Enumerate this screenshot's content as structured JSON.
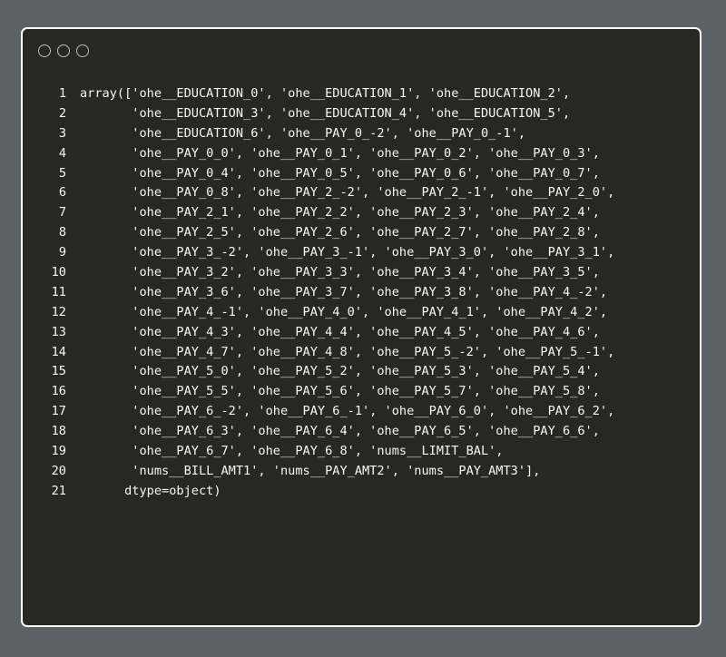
{
  "window": {
    "controls": [
      "close",
      "minimize",
      "maximize"
    ]
  },
  "code": {
    "lines": [
      "array(['ohe__EDUCATION_0', 'ohe__EDUCATION_1', 'ohe__EDUCATION_2',",
      "       'ohe__EDUCATION_3', 'ohe__EDUCATION_4', 'ohe__EDUCATION_5',",
      "       'ohe__EDUCATION_6', 'ohe__PAY_0_-2', 'ohe__PAY_0_-1',",
      "       'ohe__PAY_0_0', 'ohe__PAY_0_1', 'ohe__PAY_0_2', 'ohe__PAY_0_3',",
      "       'ohe__PAY_0_4', 'ohe__PAY_0_5', 'ohe__PAY_0_6', 'ohe__PAY_0_7',",
      "       'ohe__PAY_0_8', 'ohe__PAY_2_-2', 'ohe__PAY_2_-1', 'ohe__PAY_2_0',",
      "       'ohe__PAY_2_1', 'ohe__PAY_2_2', 'ohe__PAY_2_3', 'ohe__PAY_2_4',",
      "       'ohe__PAY_2_5', 'ohe__PAY_2_6', 'ohe__PAY_2_7', 'ohe__PAY_2_8',",
      "       'ohe__PAY_3_-2', 'ohe__PAY_3_-1', 'ohe__PAY_3_0', 'ohe__PAY_3_1',",
      "       'ohe__PAY_3_2', 'ohe__PAY_3_3', 'ohe__PAY_3_4', 'ohe__PAY_3_5',",
      "       'ohe__PAY_3_6', 'ohe__PAY_3_7', 'ohe__PAY_3_8', 'ohe__PAY_4_-2',",
      "       'ohe__PAY_4_-1', 'ohe__PAY_4_0', 'ohe__PAY_4_1', 'ohe__PAY_4_2',",
      "       'ohe__PAY_4_3', 'ohe__PAY_4_4', 'ohe__PAY_4_5', 'ohe__PAY_4_6',",
      "       'ohe__PAY_4_7', 'ohe__PAY_4_8', 'ohe__PAY_5_-2', 'ohe__PAY_5_-1',",
      "       'ohe__PAY_5_0', 'ohe__PAY_5_2', 'ohe__PAY_5_3', 'ohe__PAY_5_4',",
      "       'ohe__PAY_5_5', 'ohe__PAY_5_6', 'ohe__PAY_5_7', 'ohe__PAY_5_8',",
      "       'ohe__PAY_6_-2', 'ohe__PAY_6_-1', 'ohe__PAY_6_0', 'ohe__PAY_6_2',",
      "       'ohe__PAY_6_3', 'ohe__PAY_6_4', 'ohe__PAY_6_5', 'ohe__PAY_6_6',",
      "       'ohe__PAY_6_7', 'ohe__PAY_6_8', 'nums__LIMIT_BAL',",
      "       'nums__BILL_AMT1', 'nums__PAY_AMT2', 'nums__PAY_AMT3'],",
      "      dtype=object)"
    ]
  }
}
